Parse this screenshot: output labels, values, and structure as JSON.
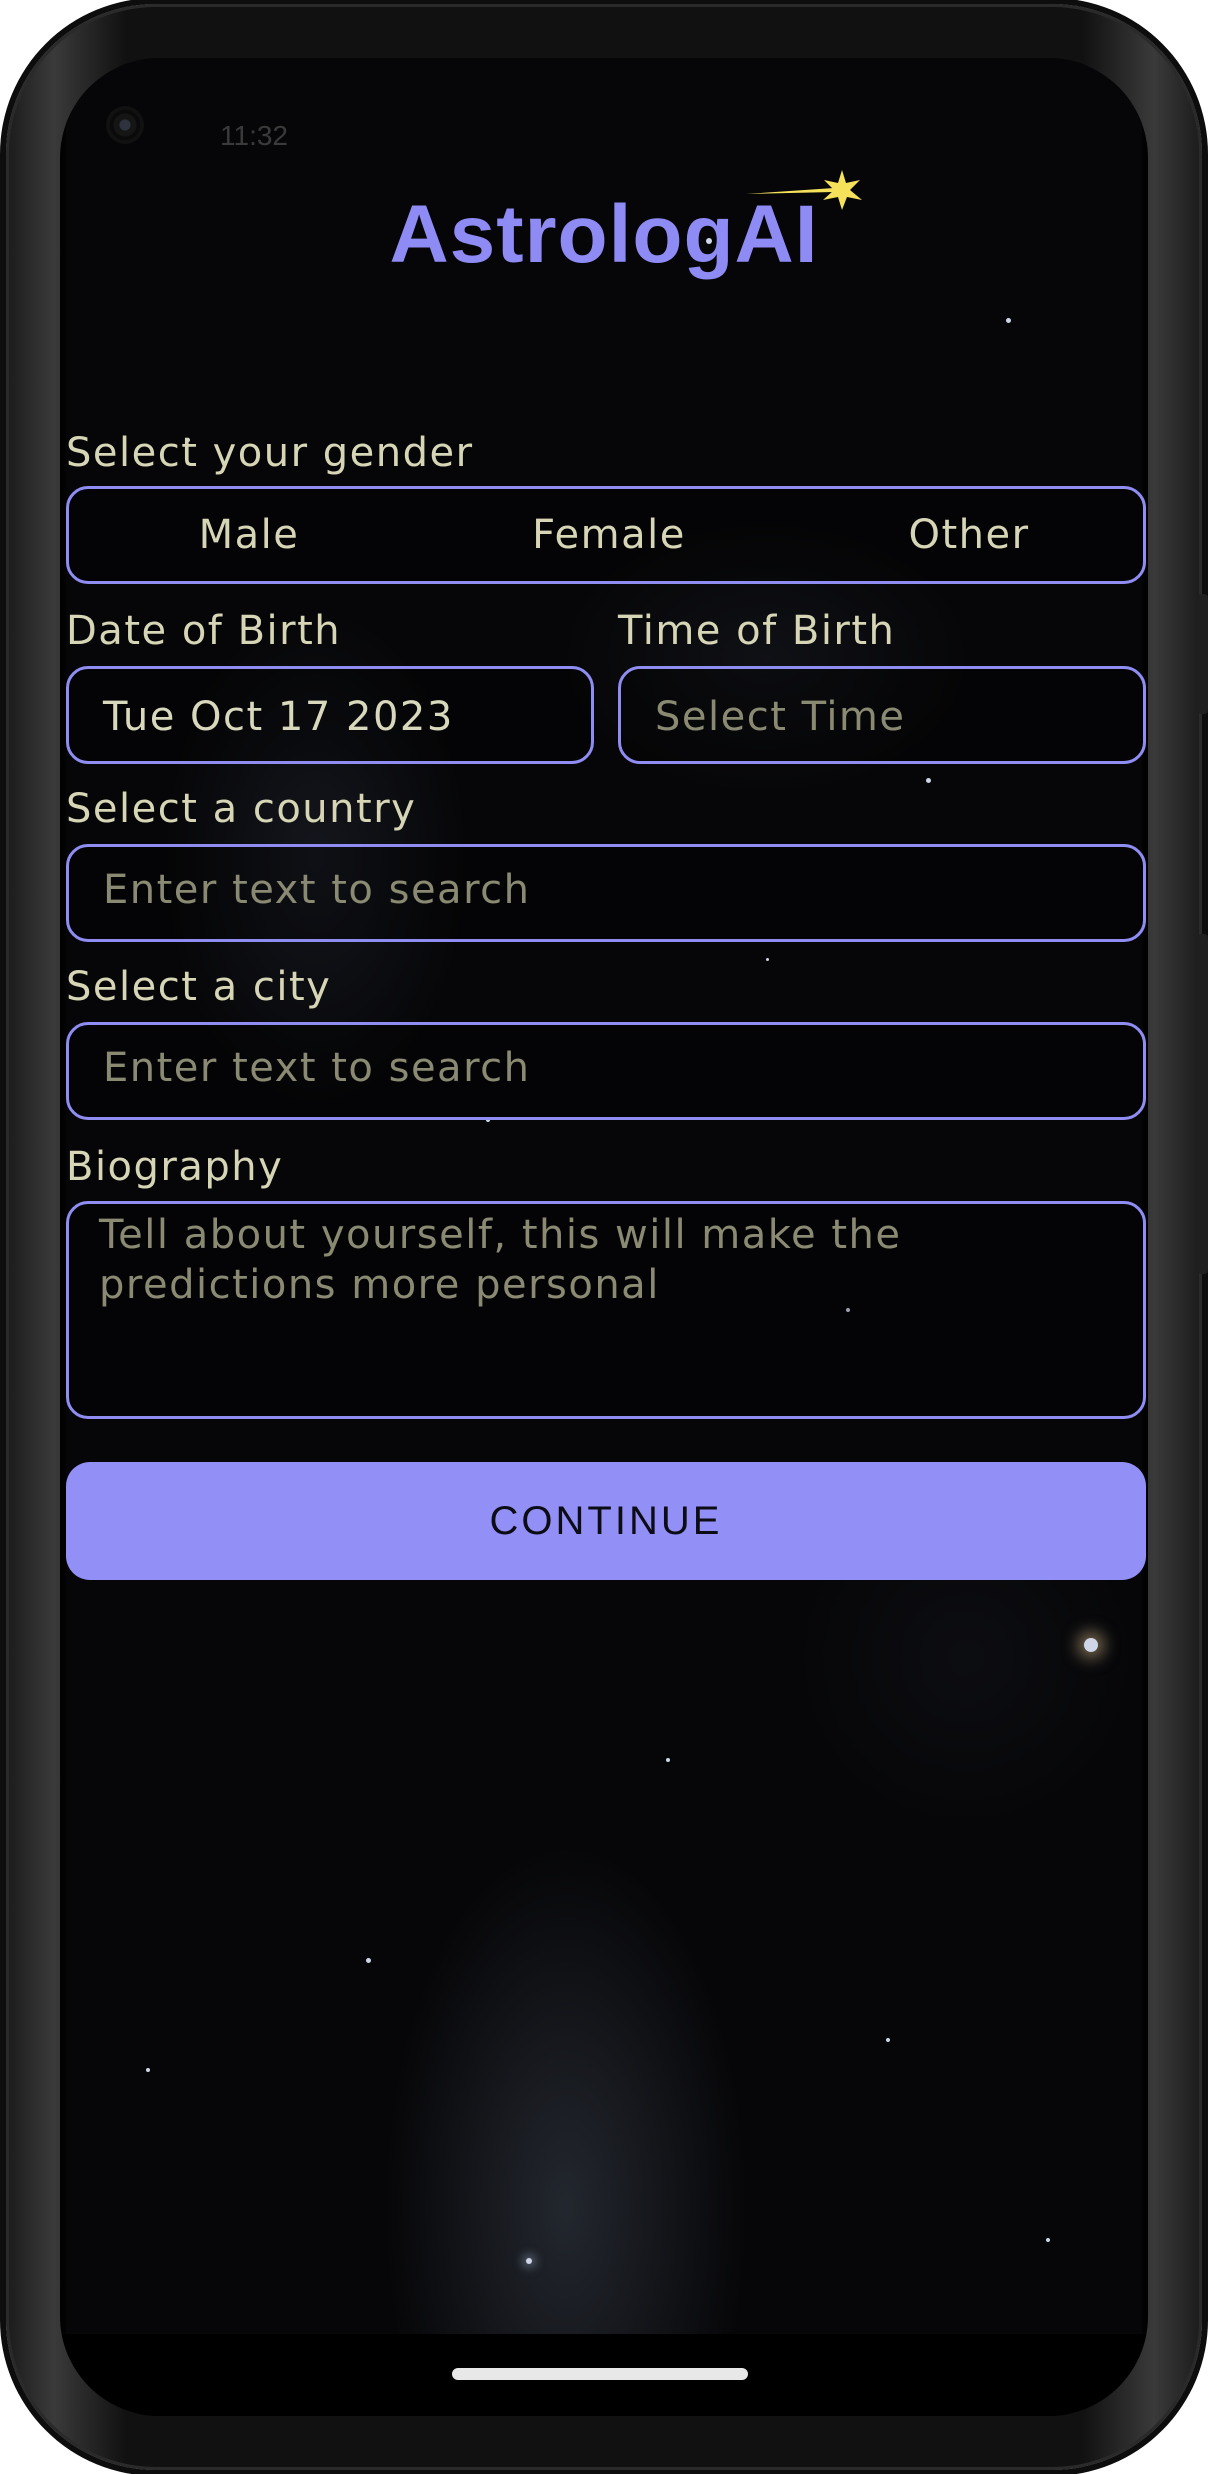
{
  "status_bar": {
    "time": "11:32"
  },
  "app": {
    "title": "AstrologAI"
  },
  "gender": {
    "label": "Select your gender",
    "options": [
      "Male",
      "Female",
      "Other"
    ]
  },
  "date_of_birth": {
    "label": "Date of Birth",
    "value": "Tue Oct 17 2023"
  },
  "time_of_birth": {
    "label": "Time of Birth",
    "placeholder": "Select Time"
  },
  "country": {
    "label": "Select a country",
    "placeholder": "Enter text to search"
  },
  "city": {
    "label": "Select a city",
    "placeholder": "Enter text to search"
  },
  "biography": {
    "label": "Biography",
    "placeholder": "Tell about yourself, this will make the predictions more personal"
  },
  "continue_button": {
    "label": "CONTINUE"
  },
  "colors": {
    "accent": "#8f8cf2",
    "button": "#928ff7",
    "label_text": "#d6d6b6",
    "placeholder_text": "#8a8a73",
    "logo_star": "#f5e15a"
  },
  "icons": [
    "camera-icon",
    "logo-star-icon",
    "home-indicator"
  ]
}
